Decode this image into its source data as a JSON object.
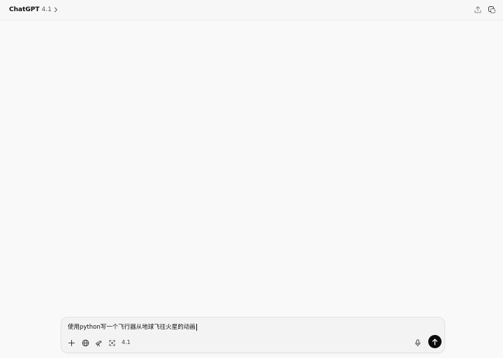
{
  "header": {
    "app_name": "ChatGPT",
    "model_version": "4.1",
    "icons": {
      "chevron": "chevron-right-icon",
      "share": "share-icon",
      "temporary_chat": "temporary-chat-icon"
    }
  },
  "composer": {
    "input_value": "使用python写一个飞行器从地球飞往火星的动画",
    "model_label": "4.1",
    "icons": {
      "add": "plus-icon",
      "web_search": "globe-icon",
      "deep_research": "telescope-icon",
      "image": "image-sparkle-icon",
      "voice": "microphone-icon",
      "send": "arrow-up-icon"
    }
  },
  "colors": {
    "background": "#f9f9f9",
    "composer_background": "#f3f3f3",
    "send_button": "#0d0d0d"
  }
}
